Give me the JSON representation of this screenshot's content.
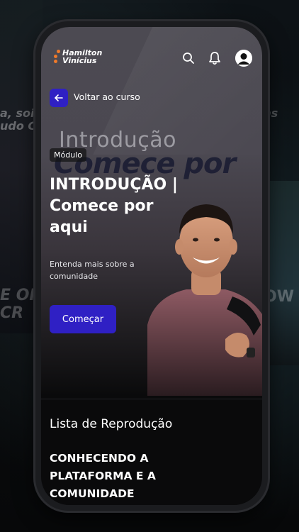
{
  "background": {
    "left_text_top": "a, soi",
    "left_text_mid": "udo Co",
    "left_text_bottom": "E OF CR",
    "right_text_top": "as",
    "right_text_bottom": "OW"
  },
  "header": {
    "logo_line1": "Hamilton",
    "logo_line2": "Vinícius",
    "search_icon": "search-icon",
    "bell_icon": "bell-icon",
    "avatar_icon": "user-avatar-icon"
  },
  "nav": {
    "back_label": "Voltar ao curso"
  },
  "hero": {
    "watermark_1": "Introdução",
    "watermark_2": "Comece por",
    "badge": "Módulo",
    "title": "INTRODUÇÃO | Comece por aqui",
    "subtitle": "Entenda mais sobre a comunidade",
    "start_button": "Começar"
  },
  "playlist": {
    "heading": "Lista de Reprodução",
    "first_lesson": "CONHECENDO A PLATAFORMA E A COMUNIDADE"
  },
  "colors": {
    "accent": "#2f20c4",
    "logo_dot": "#f07a2a"
  }
}
